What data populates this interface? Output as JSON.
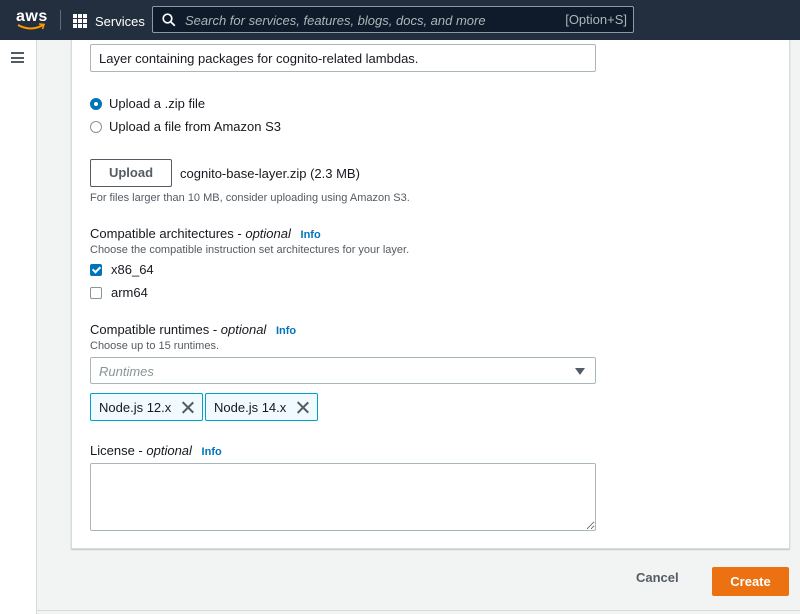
{
  "nav": {
    "logo": "aws",
    "services_label": "Services",
    "search_placeholder": "Search for services, features, blogs, docs, and more",
    "search_shortcut": "[Option+S]"
  },
  "form": {
    "description_value": "Layer containing packages for cognito-related lambdas.",
    "upload_options": [
      {
        "label": "Upload a .zip file",
        "checked": true
      },
      {
        "label": "Upload a file from Amazon S3",
        "checked": false
      }
    ],
    "upload_button": "Upload",
    "file_name": "cognito-base-layer.zip (2.3 MB)",
    "file_hint": "For files larger than 10 MB, consider uploading using Amazon S3.",
    "architectures": {
      "label": "Compatible architectures - ",
      "optional": "optional",
      "info": "Info",
      "hint": "Choose the compatible instruction set architectures for your layer.",
      "options": [
        {
          "label": "x86_64",
          "checked": true
        },
        {
          "label": "arm64",
          "checked": false
        }
      ]
    },
    "runtimes": {
      "label": "Compatible runtimes - ",
      "optional": "optional",
      "info": "Info",
      "hint": "Choose up to 15 runtimes.",
      "placeholder": "Runtimes",
      "tokens": [
        "Node.js 12.x",
        "Node.js 14.x"
      ]
    },
    "license": {
      "label": "License - ",
      "optional": "optional",
      "info": "Info",
      "value": ""
    }
  },
  "actions": {
    "cancel": "Cancel",
    "create": "Create"
  },
  "colors": {
    "nav_bg": "#232f3e",
    "accent": "#0073bb",
    "primary_button": "#ec7211"
  }
}
